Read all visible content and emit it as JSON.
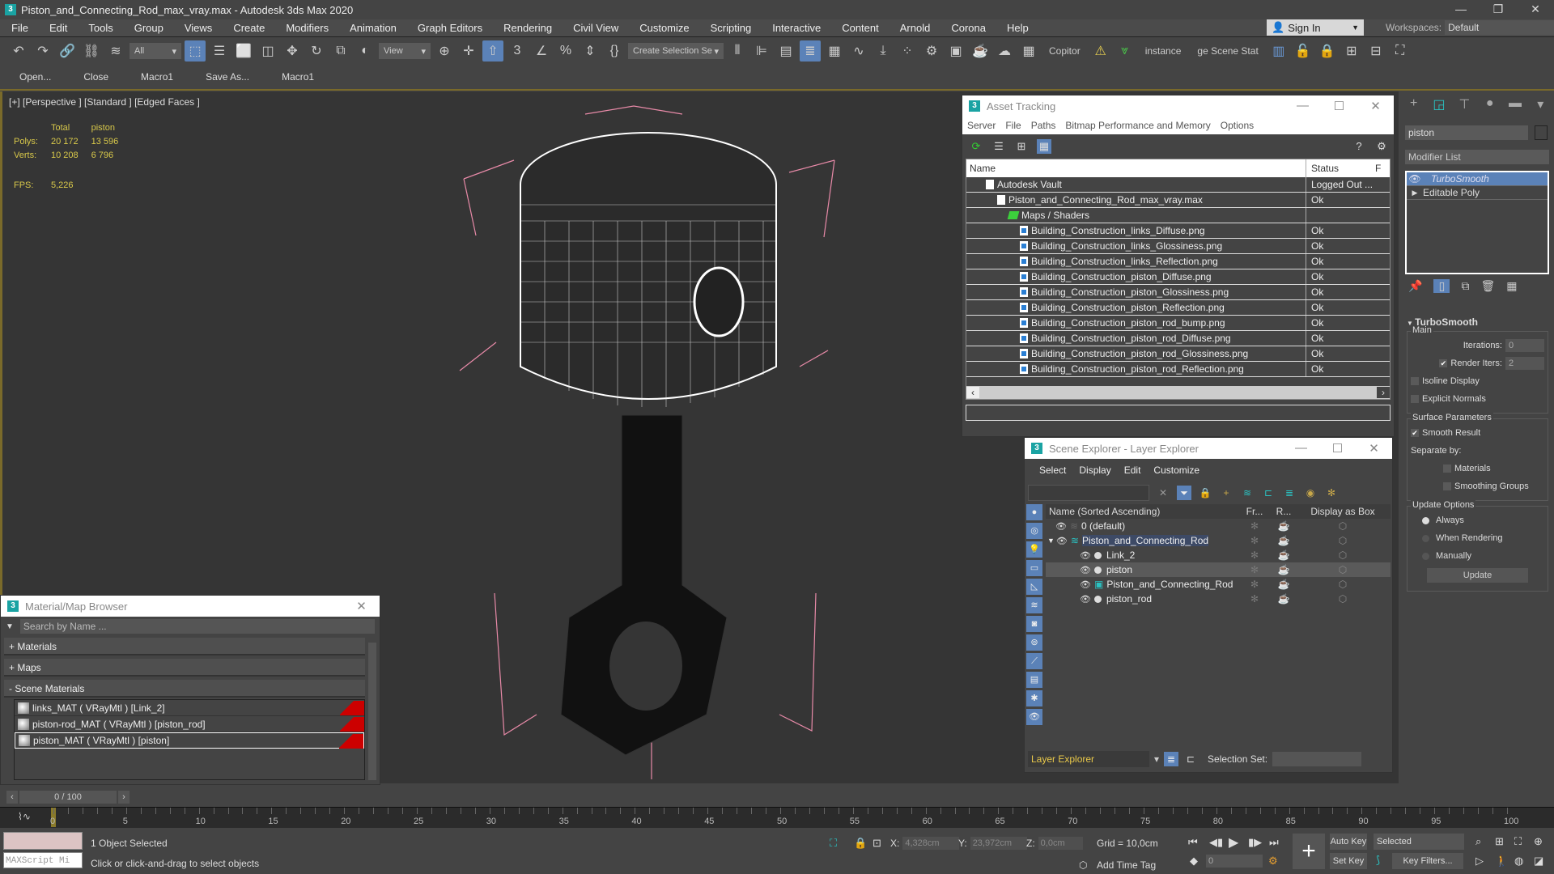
{
  "app": {
    "title": "Piston_and_Connecting_Rod_max_vray.max - Autodesk 3ds Max 2020",
    "icon": "3ds-max-icon"
  },
  "menu": [
    "File",
    "Edit",
    "Tools",
    "Group",
    "Views",
    "Create",
    "Modifiers",
    "Animation",
    "Graph Editors",
    "Rendering",
    "Civil View",
    "Customize",
    "Scripting",
    "Interactive",
    "Content",
    "Arnold",
    "Corona",
    "Help"
  ],
  "account": {
    "sign_in": "Sign In",
    "workspaces_label": "Workspaces:",
    "workspace": "Default"
  },
  "toolbar": {
    "filter": "All",
    "ref_coord": "View",
    "selection_set": "Create Selection Se",
    "copitor": "Copitor",
    "instance": "instance",
    "scene_states": "ge Scene Stat"
  },
  "macrobar": [
    "Open...",
    "Close",
    "Macro1",
    "Save As...",
    "Macro1"
  ],
  "viewport": {
    "label": "[+] [Perspective ] [Standard ] [Edged Faces ]",
    "stats": {
      "col_total": "Total",
      "col_sel": "piston",
      "polys_label": "Polys:",
      "polys_total": "20 172",
      "polys_sel": "13 596",
      "verts_label": "Verts:",
      "verts_total": "10 208",
      "verts_sel": "6 796",
      "fps_label": "FPS:",
      "fps": "5,226"
    }
  },
  "asset_tracking": {
    "title": "Asset Tracking",
    "menu": [
      "Server",
      "File",
      "Paths",
      "Bitmap Performance and Memory",
      "Options"
    ],
    "columns": {
      "name": "Name",
      "status": "Status",
      "extra": "F"
    },
    "rows": [
      {
        "name": "Autodesk Vault",
        "status": "Logged Out ...",
        "level": 1,
        "icon": "vault-icon"
      },
      {
        "name": "Piston_and_Connecting_Rod_max_vray.max",
        "status": "Ok",
        "level": 2,
        "icon": "file-icon"
      },
      {
        "name": "Maps / Shaders",
        "status": "",
        "level": 3,
        "icon": "maps-icon"
      },
      {
        "name": "Building_Construction_links_Diffuse.png",
        "status": "Ok",
        "level": 4,
        "icon": "image-icon"
      },
      {
        "name": "Building_Construction_links_Glossiness.png",
        "status": "Ok",
        "level": 4,
        "icon": "image-icon"
      },
      {
        "name": "Building_Construction_links_Reflection.png",
        "status": "Ok",
        "level": 4,
        "icon": "image-icon"
      },
      {
        "name": "Building_Construction_piston_Diffuse.png",
        "status": "Ok",
        "level": 4,
        "icon": "image-icon"
      },
      {
        "name": "Building_Construction_piston_Glossiness.png",
        "status": "Ok",
        "level": 4,
        "icon": "image-icon"
      },
      {
        "name": "Building_Construction_piston_Reflection.png",
        "status": "Ok",
        "level": 4,
        "icon": "image-icon"
      },
      {
        "name": "Building_Construction_piston_rod_bump.png",
        "status": "Ok",
        "level": 4,
        "icon": "image-icon"
      },
      {
        "name": "Building_Construction_piston_rod_Diffuse.png",
        "status": "Ok",
        "level": 4,
        "icon": "image-icon"
      },
      {
        "name": "Building_Construction_piston_rod_Glossiness.png",
        "status": "Ok",
        "level": 4,
        "icon": "image-icon"
      },
      {
        "name": "Building_Construction_piston_rod_Reflection.png",
        "status": "Ok",
        "level": 4,
        "icon": "image-icon"
      }
    ]
  },
  "scene_explorer": {
    "title": "Scene Explorer - Layer Explorer",
    "menu": [
      "Select",
      "Display",
      "Edit",
      "Customize"
    ],
    "columns": {
      "name": "Name (Sorted Ascending)",
      "frozen": "Fr...",
      "render": "R...",
      "box": "Display as Box"
    },
    "rows": [
      {
        "name": "0 (default)",
        "level": 1,
        "type": "layer"
      },
      {
        "name": "Piston_and_Connecting_Rod",
        "level": 1,
        "type": "layer-active"
      },
      {
        "name": "Link_2",
        "level": 2,
        "type": "object"
      },
      {
        "name": "piston",
        "level": 2,
        "type": "object",
        "selected": true
      },
      {
        "name": "Piston_and_Connecting_Rod",
        "level": 2,
        "type": "group"
      },
      {
        "name": "piston_rod",
        "level": 2,
        "type": "object"
      }
    ],
    "explorer_select": "Layer Explorer",
    "selection_set_label": "Selection Set:"
  },
  "command_panel": {
    "object_name": "piston",
    "modifier_list": "Modifier List",
    "stack": [
      "TurboSmooth",
      "Editable Poly"
    ],
    "turbosmooth": {
      "title": "TurboSmooth",
      "main": "Main",
      "iterations_label": "Iterations:",
      "iterations": "0",
      "render_iters_label": "Render Iters:",
      "render_iters": "2",
      "render_iters_checked": true,
      "isoline": "Isoline Display",
      "explicit": "Explicit Normals",
      "surface": "Surface Parameters",
      "smooth_result": "Smooth Result",
      "separate_by": "Separate by:",
      "materials": "Materials",
      "smoothing_groups": "Smoothing Groups",
      "update_options": "Update Options",
      "always": "Always",
      "when_rendering": "When Rendering",
      "manually": "Manually",
      "update_btn": "Update"
    }
  },
  "material_browser": {
    "title": "Material/Map Browser",
    "search_placeholder": "Search by Name ...",
    "categories": [
      "+ Materials",
      "+ Maps",
      "- Scene Materials"
    ],
    "materials": [
      "links_MAT ( VRayMtl ) [Link_2]",
      "piston-rod_MAT ( VRayMtl ) [piston_rod]",
      "piston_MAT ( VRayMtl ) [piston]"
    ]
  },
  "timeline": {
    "frame_display": "0 / 100",
    "ticks": [
      "0",
      "5",
      "10",
      "15",
      "20",
      "25",
      "30",
      "35",
      "40",
      "45",
      "50",
      "55",
      "60",
      "65",
      "70",
      "75",
      "80",
      "85",
      "90",
      "95",
      "100"
    ]
  },
  "status": {
    "maxscript": "MAXScript Mi",
    "selected": "1 Object Selected",
    "prompt": "Click or click-and-drag to select objects",
    "x_label": "X:",
    "x": "4,328cm",
    "y_label": "Y:",
    "y": "23,972cm",
    "z_label": "Z:",
    "z": "0,0cm",
    "grid": "Grid = 10,0cm",
    "add_time_tag": "Add Time Tag",
    "frame": "0",
    "auto_key": "Auto Key",
    "set_key": "Set Key",
    "key_mode": "Selected",
    "key_filters": "Key Filters..."
  }
}
